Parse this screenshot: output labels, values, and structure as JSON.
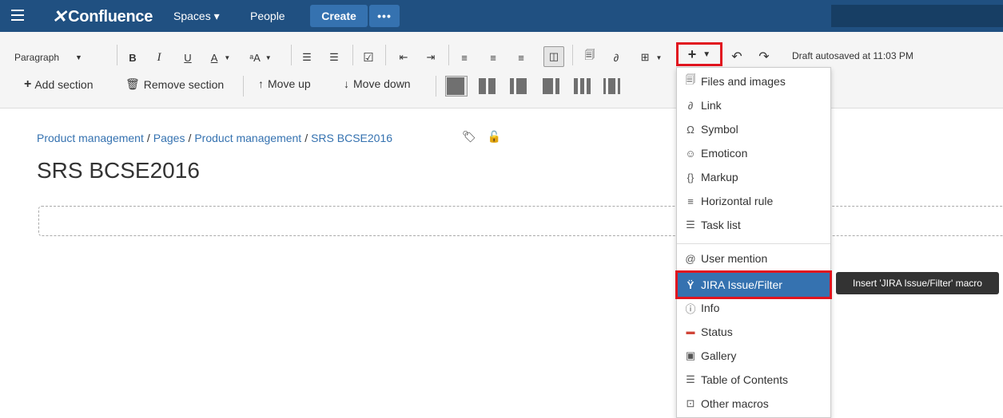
{
  "header": {
    "logo_text": "Confluence",
    "spaces_label": "Spaces ▾",
    "people_label": "People",
    "create_label": "Create",
    "more_label": "•••"
  },
  "toolbar": {
    "paragraph_label": "Paragraph",
    "bold": "B",
    "italic": "I",
    "underline": "U",
    "text_color": "A",
    "insert_plus": "+",
    "autosave_text": "Draft autosaved at 11:03 PM",
    "add_section": "Add section",
    "remove_section": "Remove section",
    "move_up": "Move up",
    "move_down": "Move down"
  },
  "breadcrumb": {
    "items": [
      "Product management",
      "Pages",
      "Product management",
      "SRS BCSE2016"
    ],
    "separator": "/"
  },
  "page_title": "SRS BCSE2016",
  "insert_menu": {
    "items": [
      {
        "label": "Files and images",
        "icon": "files-icon"
      },
      {
        "label": "Link",
        "icon": "link-icon"
      },
      {
        "label": "Symbol",
        "icon": "omega-icon"
      },
      {
        "label": "Emoticon",
        "icon": "smiley-icon"
      },
      {
        "label": "Markup",
        "icon": "braces-icon"
      },
      {
        "label": "Horizontal rule",
        "icon": "hr-icon"
      },
      {
        "label": "Task list",
        "icon": "tasklist-icon"
      },
      {
        "label": "User mention",
        "icon": "at-icon"
      },
      {
        "label": "JIRA Issue/Filter",
        "icon": "jira-icon"
      },
      {
        "label": "Info",
        "icon": "info-icon"
      },
      {
        "label": "Status",
        "icon": "status-icon"
      },
      {
        "label": "Gallery",
        "icon": "gallery-icon"
      },
      {
        "label": "Table of Contents",
        "icon": "toc-icon"
      },
      {
        "label": "Other macros",
        "icon": "macros-icon"
      }
    ],
    "highlighted": "JIRA Issue/Filter"
  },
  "tooltip": "Insert 'JIRA Issue/Filter' macro",
  "colors": {
    "header_bg": "#205081",
    "create_bg": "#3572b0",
    "highlight_bg": "#3572b0",
    "callout_red": "#e1151f",
    "link_blue": "#3572b0"
  }
}
